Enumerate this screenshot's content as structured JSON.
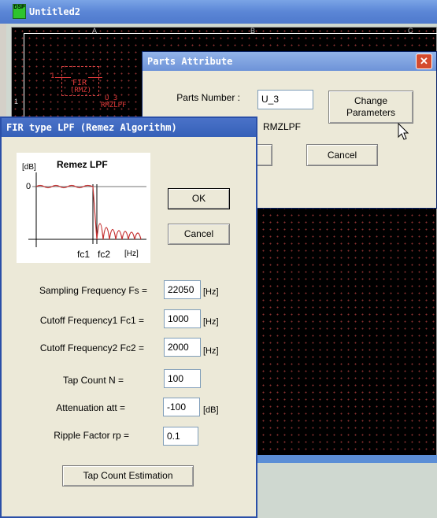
{
  "main_window": {
    "title": "Untitled2",
    "icon_letters": "DSP"
  },
  "schematic": {
    "columns": [
      "A",
      "B",
      "C"
    ],
    "row": "1",
    "block": {
      "pin": "1",
      "name": "FIR",
      "sub": "(RMZ)",
      "ref": "U_3",
      "part": "RMZLPF"
    }
  },
  "parts_attribute": {
    "title": "Parts Attribute",
    "parts_number_label": "Parts Number :",
    "parts_number_value": "U_3",
    "change_params": "Change Parameters",
    "part_type": "RMZLPF",
    "cancel": "Cancel"
  },
  "fir_dialog": {
    "title": "FIR type LPF (Remez Algorithm)",
    "graph": {
      "title": "Remez LPF",
      "ylabel": "[dB]",
      "zero": "0",
      "fc1": "fc1",
      "fc2": "fc2",
      "hz": "[Hz]"
    },
    "ok": "OK",
    "cancel": "Cancel",
    "fields": [
      {
        "label": "Sampling Frequency Fs =",
        "value": "22050",
        "unit": "[Hz]"
      },
      {
        "label": "Cutoff Frequency1 Fc1 =",
        "value": "1000",
        "unit": "[Hz]"
      },
      {
        "label": "Cutoff Frequency2 Fc2 =",
        "value": "2000",
        "unit": "[Hz]"
      },
      {
        "label": "Tap Count N =",
        "value": "100",
        "unit": ""
      },
      {
        "label": "Attenuation att =",
        "value": "-100",
        "unit": "[dB]"
      },
      {
        "label": "Ripple Factor rp =",
        "value": "0.1",
        "unit": ""
      }
    ],
    "tap_estimation": "Tap Count Estimation"
  }
}
